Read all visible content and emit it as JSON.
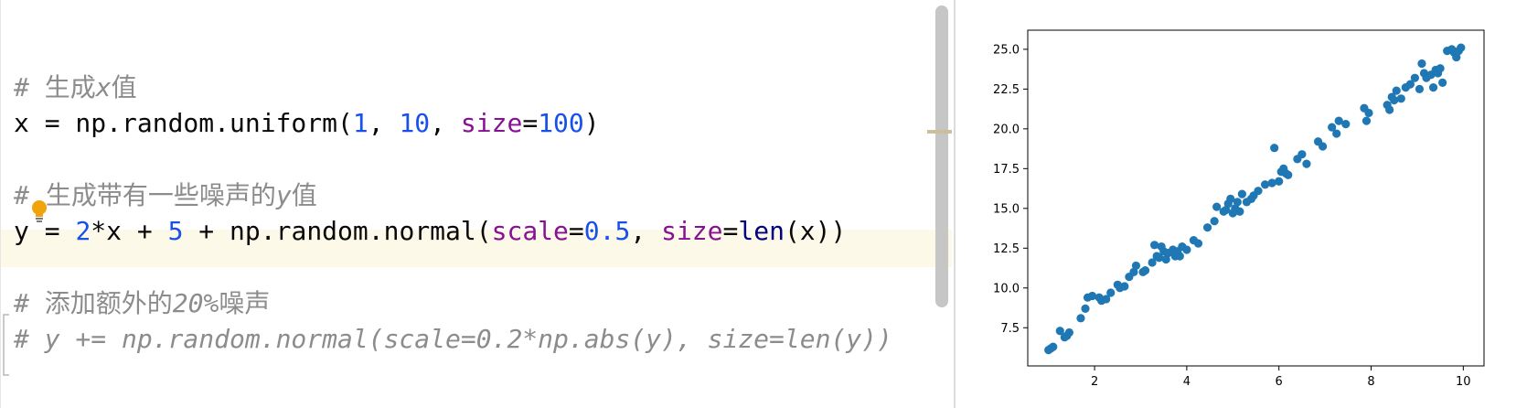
{
  "editor": {
    "lines": {
      "c1_hash": "# ",
      "c1_text": "生成",
      "c1_var": "x",
      "c1_text2": "值",
      "l2_a": "x = np.random.uniform(",
      "l2_n1": "1",
      "l2_sep1": ", ",
      "l2_n2": "10",
      "l2_sep2": ", ",
      "l2_kw": "size",
      "l2_eq": "=",
      "l2_n3": "100",
      "l2_end": ")",
      "c2_hash": "#",
      "c2_text": "生成带有一些噪声的",
      "c2_var": "y",
      "c2_text2": "值",
      "l4_a": "y = ",
      "l4_n1": "2",
      "l4_b": "*x + ",
      "l4_n2": "5",
      "l4_c": " + np.random.normal(",
      "l4_kw1": "scale",
      "l4_eq1": "=",
      "l4_n3": "0.5",
      "l4_sep": ", ",
      "l4_kw2": "size",
      "l4_eq2": "=",
      "l4_fn": "len",
      "l4_end": "(x))",
      "c3_hash": "# ",
      "c3_text": "添加额外的",
      "c3_pct": "20%",
      "c3_text2": "噪声",
      "c4": "# y += np.random.normal(scale=0.2*np.abs(y), size=len(y))"
    }
  },
  "chart_data": {
    "type": "scatter",
    "title": "",
    "xlabel": "",
    "ylabel": "",
    "xlim": [
      0.55,
      10.45
    ],
    "ylim": [
      5.1,
      26.2
    ],
    "xticks": [
      "2",
      "4",
      "6",
      "8",
      "10"
    ],
    "yticks": [
      "7.5",
      "10.0",
      "12.5",
      "15.0",
      "17.5",
      "20.0",
      "22.5",
      "25.0"
    ],
    "color": "#1f77b4",
    "x": [
      1.0,
      1.05,
      1.1,
      1.25,
      1.35,
      1.45,
      1.4,
      1.7,
      1.8,
      1.85,
      1.95,
      2.1,
      2.15,
      2.25,
      2.35,
      2.5,
      2.55,
      2.65,
      2.75,
      2.85,
      2.9,
      3.05,
      3.1,
      3.25,
      3.3,
      3.35,
      3.4,
      3.45,
      3.5,
      3.55,
      3.6,
      3.7,
      3.75,
      3.8,
      3.85,
      3.9,
      4.0,
      4.15,
      4.25,
      4.45,
      4.6,
      4.65,
      4.8,
      4.85,
      4.9,
      4.95,
      5.0,
      5.05,
      5.1,
      5.15,
      5.2,
      5.3,
      5.4,
      5.45,
      5.55,
      5.7,
      5.85,
      5.9,
      6.0,
      6.05,
      6.1,
      6.15,
      6.2,
      6.4,
      6.5,
      6.6,
      6.85,
      6.95,
      7.15,
      7.25,
      7.3,
      7.45,
      7.85,
      7.9,
      7.95,
      8.35,
      8.4,
      8.45,
      8.5,
      8.55,
      8.65,
      8.75,
      8.85,
      8.95,
      9.05,
      9.1,
      9.15,
      9.2,
      9.3,
      9.35,
      9.4,
      9.45,
      9.5,
      9.55,
      9.65,
      9.75,
      9.8,
      9.85,
      9.9,
      9.95
    ],
    "y": [
      6.1,
      6.2,
      6.3,
      7.3,
      6.9,
      7.2,
      7.0,
      8.1,
      8.7,
      9.4,
      9.5,
      9.4,
      9.2,
      9.3,
      9.7,
      10.2,
      10.0,
      10.1,
      10.7,
      11.0,
      11.4,
      11.0,
      11.1,
      11.6,
      12.7,
      12.0,
      11.9,
      12.6,
      12.3,
      11.8,
      12.2,
      12.4,
      12.0,
      12.3,
      12.0,
      12.6,
      12.4,
      13.0,
      12.8,
      13.8,
      14.2,
      15.1,
      14.8,
      14.9,
      15.3,
      15.6,
      14.7,
      15.0,
      15.4,
      14.8,
      15.9,
      15.4,
      15.6,
      15.8,
      16.1,
      16.5,
      16.6,
      18.8,
      16.7,
      17.3,
      17.5,
      17.2,
      17.1,
      18.1,
      18.4,
      17.8,
      19.2,
      18.9,
      20.1,
      19.7,
      20.5,
      20.3,
      21.3,
      20.5,
      21.0,
      21.5,
      21.2,
      22.0,
      21.8,
      22.4,
      21.9,
      22.6,
      22.8,
      23.2,
      22.5,
      24.1,
      23.5,
      23.2,
      23.4,
      22.6,
      23.7,
      23.5,
      23.8,
      22.9,
      24.9,
      25.0,
      24.8,
      24.5,
      24.9,
      25.1
    ]
  }
}
